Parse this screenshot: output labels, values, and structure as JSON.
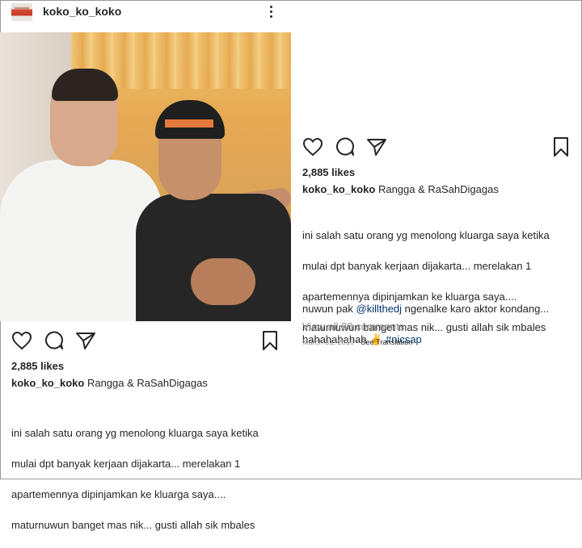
{
  "post": {
    "username": "koko_ko_koko",
    "likes": "2,885 likes",
    "caption_user": "koko_ko_koko",
    "caption_first": "Rangga & RaSahDigagas",
    "body_lines": [
      "ini salah satu orang yg menolong kluarga saya ketika",
      "mulai dpt banyak kerjaan dijakarta... merelakan 1",
      "apartemennya dipinjamkan ke kluarga saya....",
      "maturnuwun banget mas nik... gusti allah sik mbales"
    ],
    "second_para_prefix": "nuwun pak ",
    "mention": "@killthedj",
    "second_para_suffix": " ngenalke karo aktor kondang...",
    "second_para_line2_text": "hahahahahah ",
    "emoji": "✌",
    "hashtag": "#nicsap",
    "view_comments": "View all 88 comments",
    "date": "March 31, 2016",
    "separator": " • ",
    "see_translation": "See Translation"
  },
  "icons": {
    "like": "heart-icon",
    "comment": "comment-icon",
    "share": "send-icon",
    "save": "bookmark-icon",
    "more": "more-options-icon"
  }
}
